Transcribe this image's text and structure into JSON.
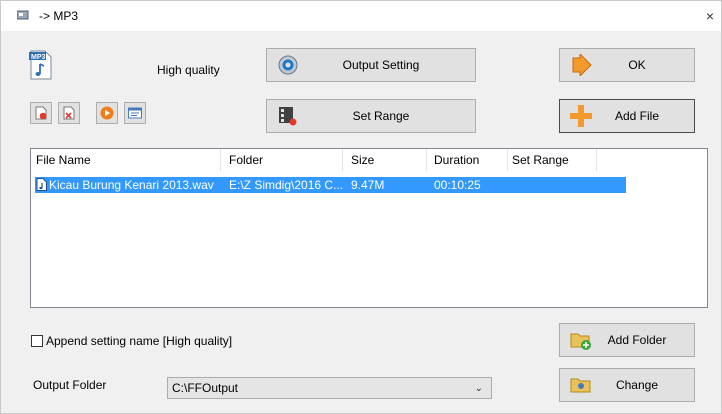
{
  "window": {
    "title": "-> MP3",
    "close_glyph": "×"
  },
  "quality_label": "High quality",
  "buttons": {
    "output_setting": "Output Setting",
    "ok": "OK",
    "set_range": "Set Range",
    "add_file": "Add File",
    "add_folder": "Add Folder",
    "change": "Change"
  },
  "toolbar_icons": [
    "clear-list-icon",
    "remove-file-icon",
    "play-icon",
    "media-info-icon"
  ],
  "list": {
    "columns": [
      "File Name",
      "Folder",
      "Size",
      "Duration",
      "Set Range"
    ],
    "rows": [
      {
        "file_name": "Kicau Burung Kenari 2013.wav",
        "folder": "E:\\Z Simdig\\2016 C...",
        "size": "9.47M",
        "duration": "00:10:25",
        "set_range": ""
      }
    ]
  },
  "append_setting": {
    "label": "Append setting name [High quality]",
    "checked": false
  },
  "output_folder": {
    "label": "Output Folder",
    "value": "C:\\FFOutput"
  },
  "colors": {
    "selection": "#3399ff",
    "button_bg": "#e1e1e1",
    "window_bg": "#f0f0f0"
  }
}
